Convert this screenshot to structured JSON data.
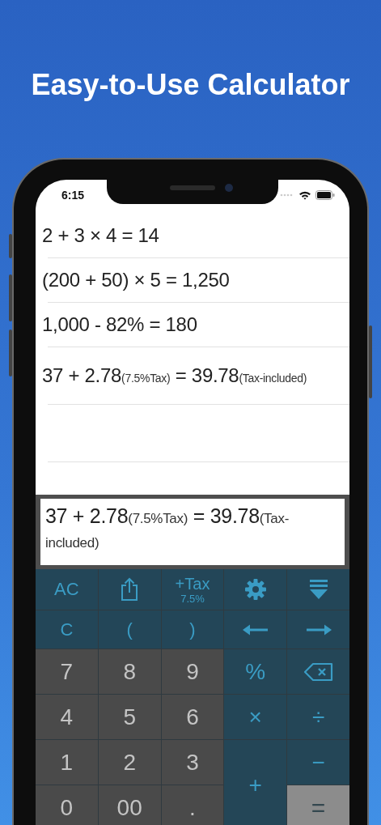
{
  "headline": "Easy-to-Use Calculator",
  "status_bar": {
    "time": "6:15"
  },
  "history": [
    {
      "parts": [
        {
          "text": "2 + 3 × 4 = 14",
          "small": false
        }
      ]
    },
    {
      "parts": [
        {
          "text": "(200 + 50) × 5 = 1,250",
          "small": false
        }
      ]
    },
    {
      "parts": [
        {
          "text": "1,000 - 82% = 180",
          "small": false
        }
      ]
    },
    {
      "parts": [
        {
          "text": "37 + 2.78",
          "small": false
        },
        {
          "text": "(7.5%Tax)",
          "small": true
        },
        {
          "text": " = 39.78",
          "small": false
        },
        {
          "text": "(Tax-included)",
          "small": true
        }
      ]
    }
  ],
  "display": {
    "parts": [
      {
        "text": "37 + 2.78",
        "small": false
      },
      {
        "text": "(7.5%Tax)",
        "small": true
      },
      {
        "text": " = 39.78",
        "small": false
      },
      {
        "text": "(Tax-included)",
        "small": true
      }
    ]
  },
  "keys": [
    {
      "label": "AC",
      "kind": "function"
    },
    {
      "kind": "share"
    },
    {
      "label": "+Tax",
      "sub": "7.5%",
      "kind": "function"
    },
    {
      "kind": "settings"
    },
    {
      "kind": "collapse"
    },
    {
      "label": "C",
      "kind": "function"
    },
    {
      "label": "(",
      "kind": "function"
    },
    {
      "label": ")",
      "kind": "function"
    },
    {
      "kind": "left"
    },
    {
      "kind": "right"
    },
    {
      "label": "7",
      "kind": "digit"
    },
    {
      "label": "8",
      "kind": "digit"
    },
    {
      "label": "9",
      "kind": "digit"
    },
    {
      "label": "%",
      "kind": "operator"
    },
    {
      "kind": "backspace"
    },
    {
      "label": "4",
      "kind": "digit"
    },
    {
      "label": "5",
      "kind": "digit"
    },
    {
      "label": "6",
      "kind": "digit"
    },
    {
      "label": "×",
      "kind": "operator"
    },
    {
      "label": "÷",
      "kind": "operator"
    },
    {
      "label": "1",
      "kind": "digit"
    },
    {
      "label": "2",
      "kind": "digit"
    },
    {
      "label": "3",
      "kind": "digit"
    },
    {
      "label": "+",
      "kind": "tall"
    },
    {
      "label": "−",
      "kind": "operator"
    },
    {
      "label": "0",
      "kind": "digit"
    },
    {
      "label": "00",
      "kind": "digit"
    },
    {
      "label": ".",
      "kind": "digit"
    },
    {
      "label": "=",
      "kind": "equals"
    }
  ]
}
